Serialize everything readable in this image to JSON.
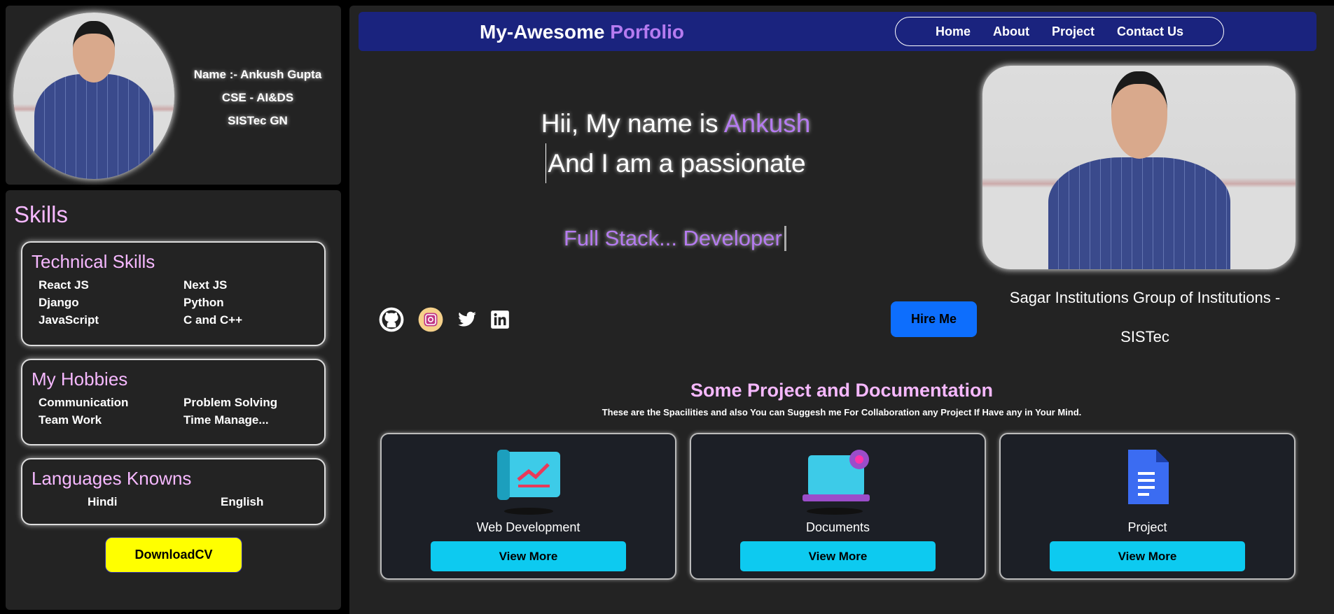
{
  "profile": {
    "name": "Name :- Ankush Gupta",
    "branch": "CSE - AI&DS",
    "college": "SISTec GN"
  },
  "skills": {
    "title": "Skills",
    "technical": {
      "title": "Technical Skills",
      "items": [
        "React JS",
        "Next JS",
        "Django",
        "Python",
        "JavaScript",
        "C and C++"
      ]
    },
    "hobbies": {
      "title": "My Hobbies",
      "items": [
        "Communication",
        "Problem Solving",
        "Team Work",
        "Time Manage..."
      ]
    },
    "languages": {
      "title": "Languages Knowns",
      "items": [
        "Hindi",
        "English"
      ]
    },
    "download_label": "DownloadCV"
  },
  "nav": {
    "brand_a": "My-Awesome",
    "brand_b": "Porfolio",
    "links": [
      "Home",
      "About",
      "Project",
      "Contact Us"
    ]
  },
  "hero": {
    "line1_a": "Hii, My name is",
    "line1_b": "Ankush",
    "line2": "And I am a passionate",
    "typed": "Full Stack... Developer",
    "hire_label": "Hire Me",
    "caption_1": "Sagar Institutions Group of Institutions -",
    "caption_2": "SISTec"
  },
  "social": [
    "github-icon",
    "instagram-icon",
    "twitter-icon",
    "linkedin-icon"
  ],
  "projects": {
    "title": "Some Project and Documentation",
    "subtitle": "These are the Spacilities and also You can Suggesh me For Collaboration any Project If Have any in Your Mind.",
    "cards": [
      {
        "title": "Web Development",
        "button": "View More"
      },
      {
        "title": "Documents",
        "button": "View More"
      },
      {
        "title": "Project",
        "button": "View More"
      }
    ]
  },
  "colors": {
    "accent": "#b57bf0",
    "pink": "#f6b8ff",
    "nav": "#1a237e",
    "hire": "#0d6efd",
    "cyan": "#0dcaf0",
    "yellow": "#ffff00"
  }
}
